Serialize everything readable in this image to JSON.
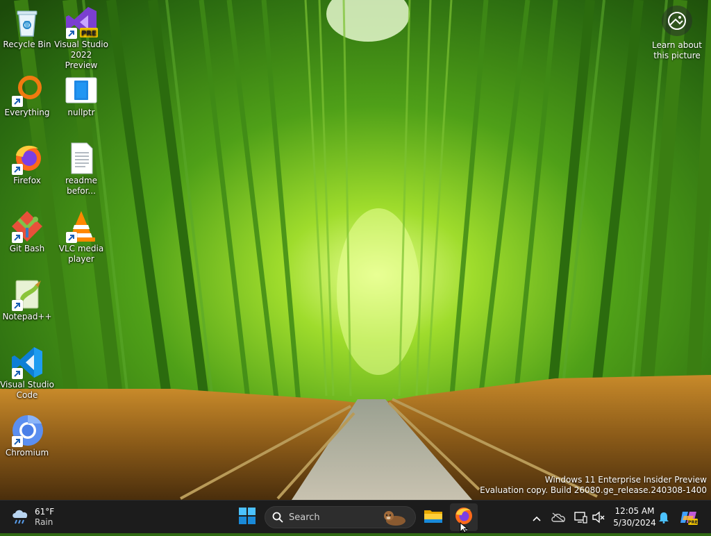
{
  "desktop": {
    "icons": [
      {
        "label": "Recycle Bin",
        "icon": "recycle-bin-icon"
      },
      {
        "label": "Visual Studio 2022 Preview",
        "icon": "visual-studio-preview-icon",
        "badge": "PRE"
      },
      {
        "label": "Everything",
        "icon": "everything-search-icon"
      },
      {
        "label": "nullptr",
        "icon": "nullptr-app-icon"
      },
      {
        "label": "Firefox",
        "icon": "firefox-icon"
      },
      {
        "label": "readme befor...",
        "icon": "text-document-icon"
      },
      {
        "label": "Git Bash",
        "icon": "git-bash-icon"
      },
      {
        "label": "VLC media player",
        "icon": "vlc-icon"
      },
      {
        "label": "Notepad++",
        "icon": "notepad-plus-plus-icon"
      },
      {
        "label": "Visual Studio Code",
        "icon": "vscode-icon"
      },
      {
        "label": "Chromium",
        "icon": "chromium-icon"
      }
    ],
    "learn_about": "Learn about this picture",
    "watermark": {
      "line1": "Windows 11 Enterprise Insider Preview",
      "line2": "Evaluation copy. Build 26080.ge_release.240308-1400"
    }
  },
  "taskbar": {
    "weather": {
      "temp": "61°F",
      "condition": "Rain"
    },
    "search_placeholder": "Search",
    "pinned": [
      {
        "name": "start",
        "icon": "windows-start-icon"
      },
      {
        "name": "file-explorer",
        "icon": "folder-icon"
      },
      {
        "name": "firefox",
        "icon": "firefox-icon",
        "active": true
      }
    ],
    "tray": {
      "icons": [
        "chevron-up-icon",
        "onedrive-icon",
        "network-icon",
        "volume-muted-icon",
        "notification-bell-icon",
        "copilot-icon"
      ]
    },
    "clock": {
      "time": "12:05 AM",
      "date": "5/30/2024"
    }
  },
  "colors": {
    "taskbar_bg": "#1c1c1c",
    "accent_blue": "#0078d4",
    "wallpaper_green": "#4c9a1a"
  }
}
